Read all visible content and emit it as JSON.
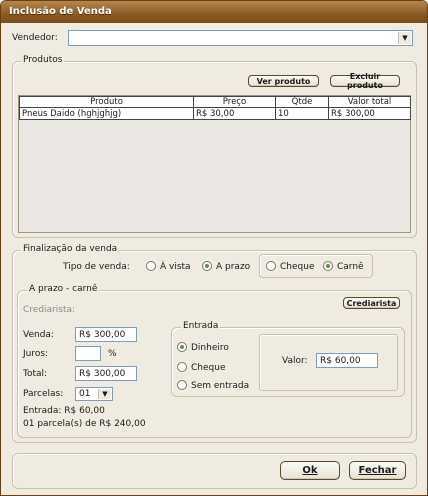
{
  "window": {
    "title": "Inclusão de Venda"
  },
  "vendedor": {
    "label": "Vendedor:",
    "value": ""
  },
  "produtos": {
    "legend": "Produtos",
    "ver_button": "Ver produto",
    "excluir_button": "Excluir produto",
    "columns": [
      "Produto",
      "Preço",
      "Qtde",
      "Valor total"
    ],
    "rows": [
      {
        "produto": "Pneus Daido (hghjghjg)",
        "preco": "R$ 30,00",
        "qtde": "10",
        "valor_total": "R$ 300,00"
      }
    ]
  },
  "finalizacao": {
    "legend": "Finalização da venda",
    "tipo_label": "Tipo de venda:",
    "tipo_options": [
      {
        "label": "À vista",
        "selected": false
      },
      {
        "label": "A prazo",
        "selected": true
      }
    ],
    "forma_options": [
      {
        "label": "Cheque",
        "selected": false
      },
      {
        "label": "Carnê",
        "selected": true
      }
    ]
  },
  "aprazo": {
    "legend": "A prazo - carnê",
    "crediarista_label": "Crediarista:",
    "crediarista_button": "Crediarista",
    "venda_label": "Venda:",
    "venda_value": "R$ 300,00",
    "juros_label": "Juros:",
    "juros_value": "",
    "juros_unit": "%",
    "total_label": "Total:",
    "total_value": "R$ 300,00",
    "parcelas_label": "Parcelas:",
    "parcelas_value": "01",
    "entrada_text": "Entrada: R$ 60,00",
    "parcela_text": "01 parcela(s) de R$ 240,00"
  },
  "entrada": {
    "legend": "Entrada",
    "options": [
      {
        "label": "Dinheiro",
        "selected": true
      },
      {
        "label": "Cheque",
        "selected": false
      },
      {
        "label": "Sem entrada",
        "selected": false
      }
    ],
    "valor_label": "Valor:",
    "valor_value": "R$ 60,00"
  },
  "footer": {
    "ok_label": "Ok",
    "fechar_label": "Fechar"
  },
  "icons": {
    "dropdown": "chevron-down-icon"
  }
}
